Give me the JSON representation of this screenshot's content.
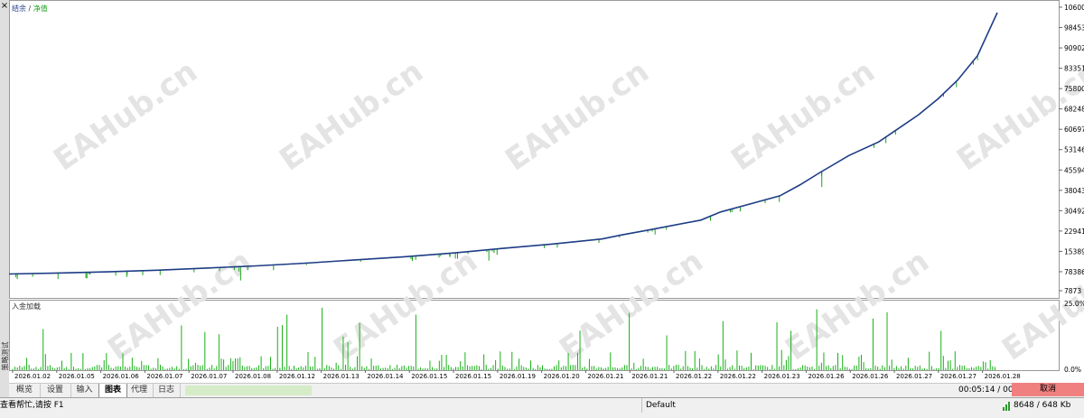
{
  "window": {
    "close_glyph": "×",
    "side_label": "策略测试"
  },
  "chart": {
    "legend_balance": "结余",
    "legend_sep": " / ",
    "legend_equity": "净值",
    "sub_label": "入金加载",
    "watermark": "EAHub.cn",
    "colors": {
      "balance": "#1f3d87",
      "equity": "#1aa51a",
      "volume": "#18b018",
      "grid": "#cccccc",
      "legend_balance": "#1f3d87",
      "legend_equity": "#1aa51a"
    }
  },
  "chart_data": {
    "type": "line",
    "series": [
      {
        "name": "结余",
        "x": [
          0.0,
          0.05,
          0.1,
          0.15,
          0.2,
          0.25,
          0.3,
          0.35,
          0.4,
          0.45,
          0.5,
          0.55,
          0.6,
          0.62,
          0.65,
          0.7,
          0.72,
          0.75,
          0.78,
          0.8,
          0.82,
          0.85,
          0.88,
          0.9,
          0.92,
          0.94,
          0.96,
          0.98,
          1.0
        ],
        "y": [
          70000,
          73500,
          78000,
          84000,
          92000,
          100000,
          110000,
          122000,
          134000,
          148000,
          165000,
          181000,
          200000,
          215000,
          235000,
          270000,
          300000,
          330000,
          360000,
          400000,
          445000,
          510000,
          560000,
          610000,
          660000,
          720000,
          790000,
          880000,
          1040000
        ]
      }
    ],
    "y_ticks": [
      1060050,
      984538,
      909025,
      833512,
      758000,
      682487,
      606974,
      531462,
      455949,
      380436,
      304924,
      229411,
      153898,
      78386,
      7873
    ],
    "y_range": [
      7873,
      1060050
    ],
    "volume_y_ticks": [
      "25.0%",
      "0.0%"
    ],
    "x_ticks": [
      "2026.01.02",
      "2026.01.05",
      "2026.01.06",
      "2026.01.07",
      "2026.01.07",
      "2026.01.08",
      "2026.01.12",
      "2026.01.13",
      "2026.01.14",
      "2026.01.15",
      "2026.01.15",
      "2026.01.19",
      "2026.01.20",
      "2026.01.21",
      "2026.01.21",
      "2026.01.22",
      "2026.01.22",
      "2026.01.23",
      "2026.01.26",
      "2026.01.26",
      "2026.01.27",
      "2026.01.27",
      "2026.01.28"
    ]
  },
  "tabs": [
    {
      "label": "概览",
      "active": false
    },
    {
      "label": "设置",
      "active": false
    },
    {
      "label": "输入",
      "active": false
    },
    {
      "label": "图表",
      "active": true
    },
    {
      "label": "代理",
      "active": false
    },
    {
      "label": "日志",
      "active": false
    }
  ],
  "timer": "00:05:14 / 00:34:39",
  "status": {
    "help": "查看帮忙,请按 F1",
    "profile": "Default",
    "traffic": "8648 / 648 Kb",
    "cancel": "取消"
  }
}
